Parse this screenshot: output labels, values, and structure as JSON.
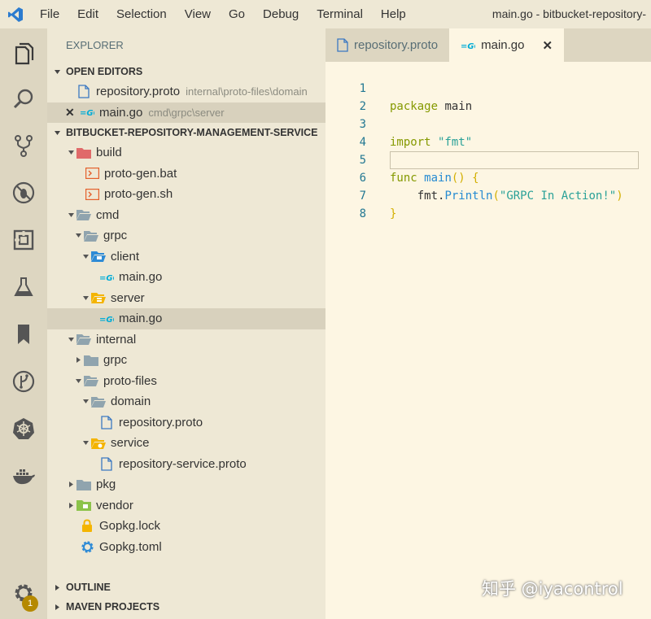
{
  "titlebar": {
    "menu": [
      "File",
      "Edit",
      "Selection",
      "View",
      "Go",
      "Debug",
      "Terminal",
      "Help"
    ],
    "window_title": "main.go - bitbucket-repository-"
  },
  "activity_bar": {
    "settings_badge": "1"
  },
  "sidebar": {
    "title": "EXPLORER",
    "open_editors": {
      "header": "OPEN EDITORS",
      "items": [
        {
          "name": "repository.proto",
          "desc": "internal\\proto-files\\domain"
        },
        {
          "name": "main.go",
          "desc": "cmd\\grpc\\server"
        }
      ]
    },
    "project": {
      "header": "BITBUCKET-REPOSITORY-MANAGEMENT-SERVICE",
      "tree": [
        {
          "label": "build",
          "depth": 0,
          "kind": "folder-open"
        },
        {
          "label": "proto-gen.bat",
          "depth": 1,
          "kind": "file"
        },
        {
          "label": "proto-gen.sh",
          "depth": 1,
          "kind": "file"
        },
        {
          "label": "cmd",
          "depth": 0,
          "kind": "folder-open"
        },
        {
          "label": "grpc",
          "depth": 1,
          "kind": "folder-open"
        },
        {
          "label": "client",
          "depth": 2,
          "kind": "folder-open"
        },
        {
          "label": "main.go",
          "depth": 3,
          "kind": "file"
        },
        {
          "label": "server",
          "depth": 2,
          "kind": "folder-open"
        },
        {
          "label": "main.go",
          "depth": 3,
          "kind": "file"
        },
        {
          "label": "internal",
          "depth": 0,
          "kind": "folder-open"
        },
        {
          "label": "grpc",
          "depth": 1,
          "kind": "folder-closed"
        },
        {
          "label": "proto-files",
          "depth": 1,
          "kind": "folder-open"
        },
        {
          "label": "domain",
          "depth": 2,
          "kind": "folder-open"
        },
        {
          "label": "repository.proto",
          "depth": 3,
          "kind": "file"
        },
        {
          "label": "service",
          "depth": 2,
          "kind": "folder-open"
        },
        {
          "label": "repository-service.proto",
          "depth": 3,
          "kind": "file"
        },
        {
          "label": "pkg",
          "depth": 0,
          "kind": "folder-closed"
        },
        {
          "label": "vendor",
          "depth": 0,
          "kind": "folder-closed"
        },
        {
          "label": "Gopkg.lock",
          "depth": 0,
          "kind": "file"
        },
        {
          "label": "Gopkg.toml",
          "depth": 0,
          "kind": "file"
        }
      ]
    },
    "outline_header": "OUTLINE",
    "maven_header": "MAVEN PROJECTS"
  },
  "editor": {
    "tabs": [
      {
        "label": "repository.proto"
      },
      {
        "label": "main.go"
      }
    ],
    "close_glyph": "✕",
    "lines": [
      {
        "num": "1",
        "tokens": [
          "package",
          " main"
        ]
      },
      {
        "num": "2"
      },
      {
        "num": "3",
        "tokens": [
          "import",
          " \"fmt\""
        ]
      },
      {
        "num": "4"
      },
      {
        "num": "5",
        "tokens": [
          "func",
          " ",
          "main",
          "()",
          " {"
        ]
      },
      {
        "num": "6",
        "tokens": [
          "    fmt.",
          "Println",
          "(",
          "\"GRPC In Action!\"",
          ")"
        ]
      },
      {
        "num": "7",
        "tokens": [
          "}"
        ]
      },
      {
        "num": "8"
      }
    ]
  },
  "watermark": "知乎 @iyacontrol",
  "colors": {
    "sidebar_bg": "#eee8d5",
    "editor_bg": "#fdf6e3",
    "activity_bg": "#ddd6c1",
    "keyword": "#859900",
    "function": "#268bd2",
    "string": "#2aa198",
    "bracket": "#d3af00",
    "line_number": "#237893",
    "go_icon": "#00acd7",
    "badge": "#b58900"
  }
}
